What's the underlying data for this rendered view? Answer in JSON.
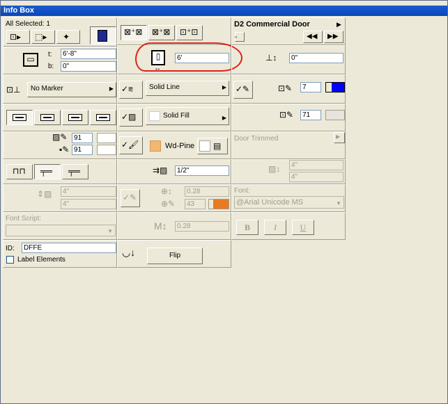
{
  "window": {
    "title": "Info Box"
  },
  "selection": {
    "label": "All Selected: 1"
  },
  "element": {
    "name": "D2 Commercial Door"
  },
  "dims": {
    "top_label": "t:",
    "top_value": "6'-8\"",
    "bottom_label": "b:",
    "bottom_value": "0\"",
    "height_value": "6'",
    "sill_value": "0\""
  },
  "marker": {
    "label": "No Marker"
  },
  "line": {
    "label": "Solid Line",
    "pen_value": "7",
    "pen_color": "#0000ff"
  },
  "fill": {
    "label": "Solid Fill",
    "pen_value": "71",
    "fill_pen_value": "91",
    "bg_pen_value": "91"
  },
  "material": {
    "label": "Wd-Pine",
    "color": "#f0b870",
    "trim_label": "Door Trimmed"
  },
  "reveal": {
    "value": "1/2\"",
    "dis_a": "4\"",
    "dis_b": "4\""
  },
  "offsets": {
    "a": "4\"",
    "b": "4\""
  },
  "text": {
    "size": "0.28",
    "pen": "43",
    "scale": "0.28",
    "font_label": "Font:",
    "font_value": "@Arial Unicode MS",
    "script_label": "Font Script:",
    "script_value": ""
  },
  "style": {
    "bold": "B",
    "italic": "I",
    "underline": "U"
  },
  "id": {
    "label": "ID:",
    "value": "DFFE",
    "label_elements": "Label Elements"
  },
  "flip": {
    "label": "Flip"
  }
}
